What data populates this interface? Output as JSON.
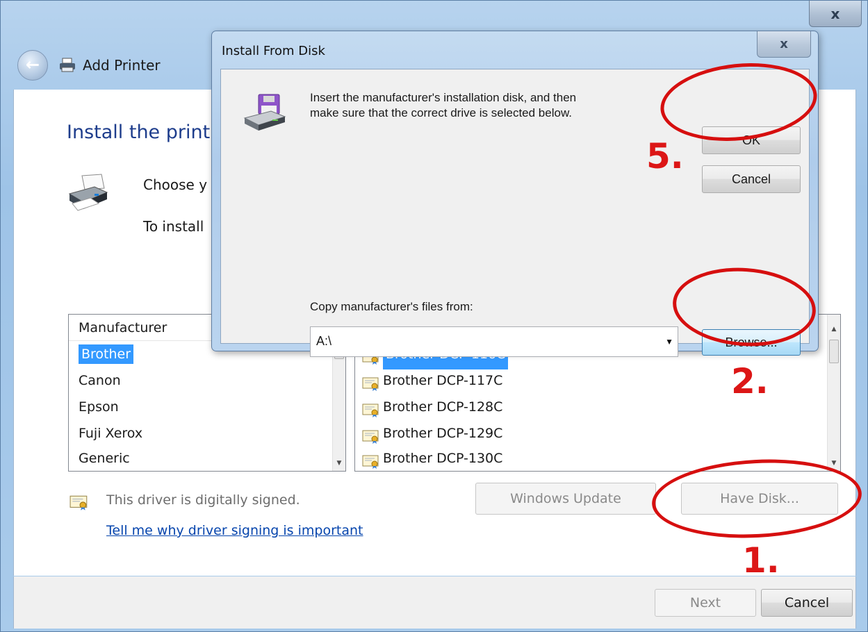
{
  "wizard": {
    "title": "Add Printer",
    "heading": "Install the print",
    "choose_text": "Choose y",
    "to_install_text": "To install",
    "manufacturer_list": {
      "header": "Manufacturer",
      "items": [
        "Brother",
        "Canon",
        "Epson",
        "Fuji Xerox",
        "Generic"
      ],
      "selected": "Brother"
    },
    "model_list": {
      "items": [
        "Brother DCP-116C",
        "Brother DCP-117C",
        "Brother DCP-128C",
        "Brother DCP-129C",
        "Brother DCP-130C"
      ],
      "selected": "Brother DCP-116C"
    },
    "signed_text": "This driver is digitally signed.",
    "signing_link": "Tell me why driver signing is important",
    "windows_update_button": "Windows Update",
    "have_disk_button": "Have Disk...",
    "next_button": "Next",
    "cancel_button": "Cancel",
    "close_glyph": "x"
  },
  "dialog": {
    "title": "Install From Disk",
    "message_line1": "Insert the manufacturer's installation disk, and then",
    "message_line2": "make sure that the correct drive is selected below.",
    "ok_button": "OK",
    "cancel_button": "Cancel",
    "copy_label": "Copy manufacturer's files from:",
    "path_value": "A:\\",
    "browse_button": "Browse...",
    "close_glyph": "x"
  },
  "annotations": {
    "step_ok": "5.",
    "step_browse": "2.",
    "step_have_disk": "1.",
    "color": "#d60f0f"
  },
  "icons": {
    "back": "back-arrow-icon",
    "printer": "printer-icon",
    "disk": "floppy-disk-drive-icon",
    "certificate": "certificate-icon",
    "close": "close-icon"
  }
}
